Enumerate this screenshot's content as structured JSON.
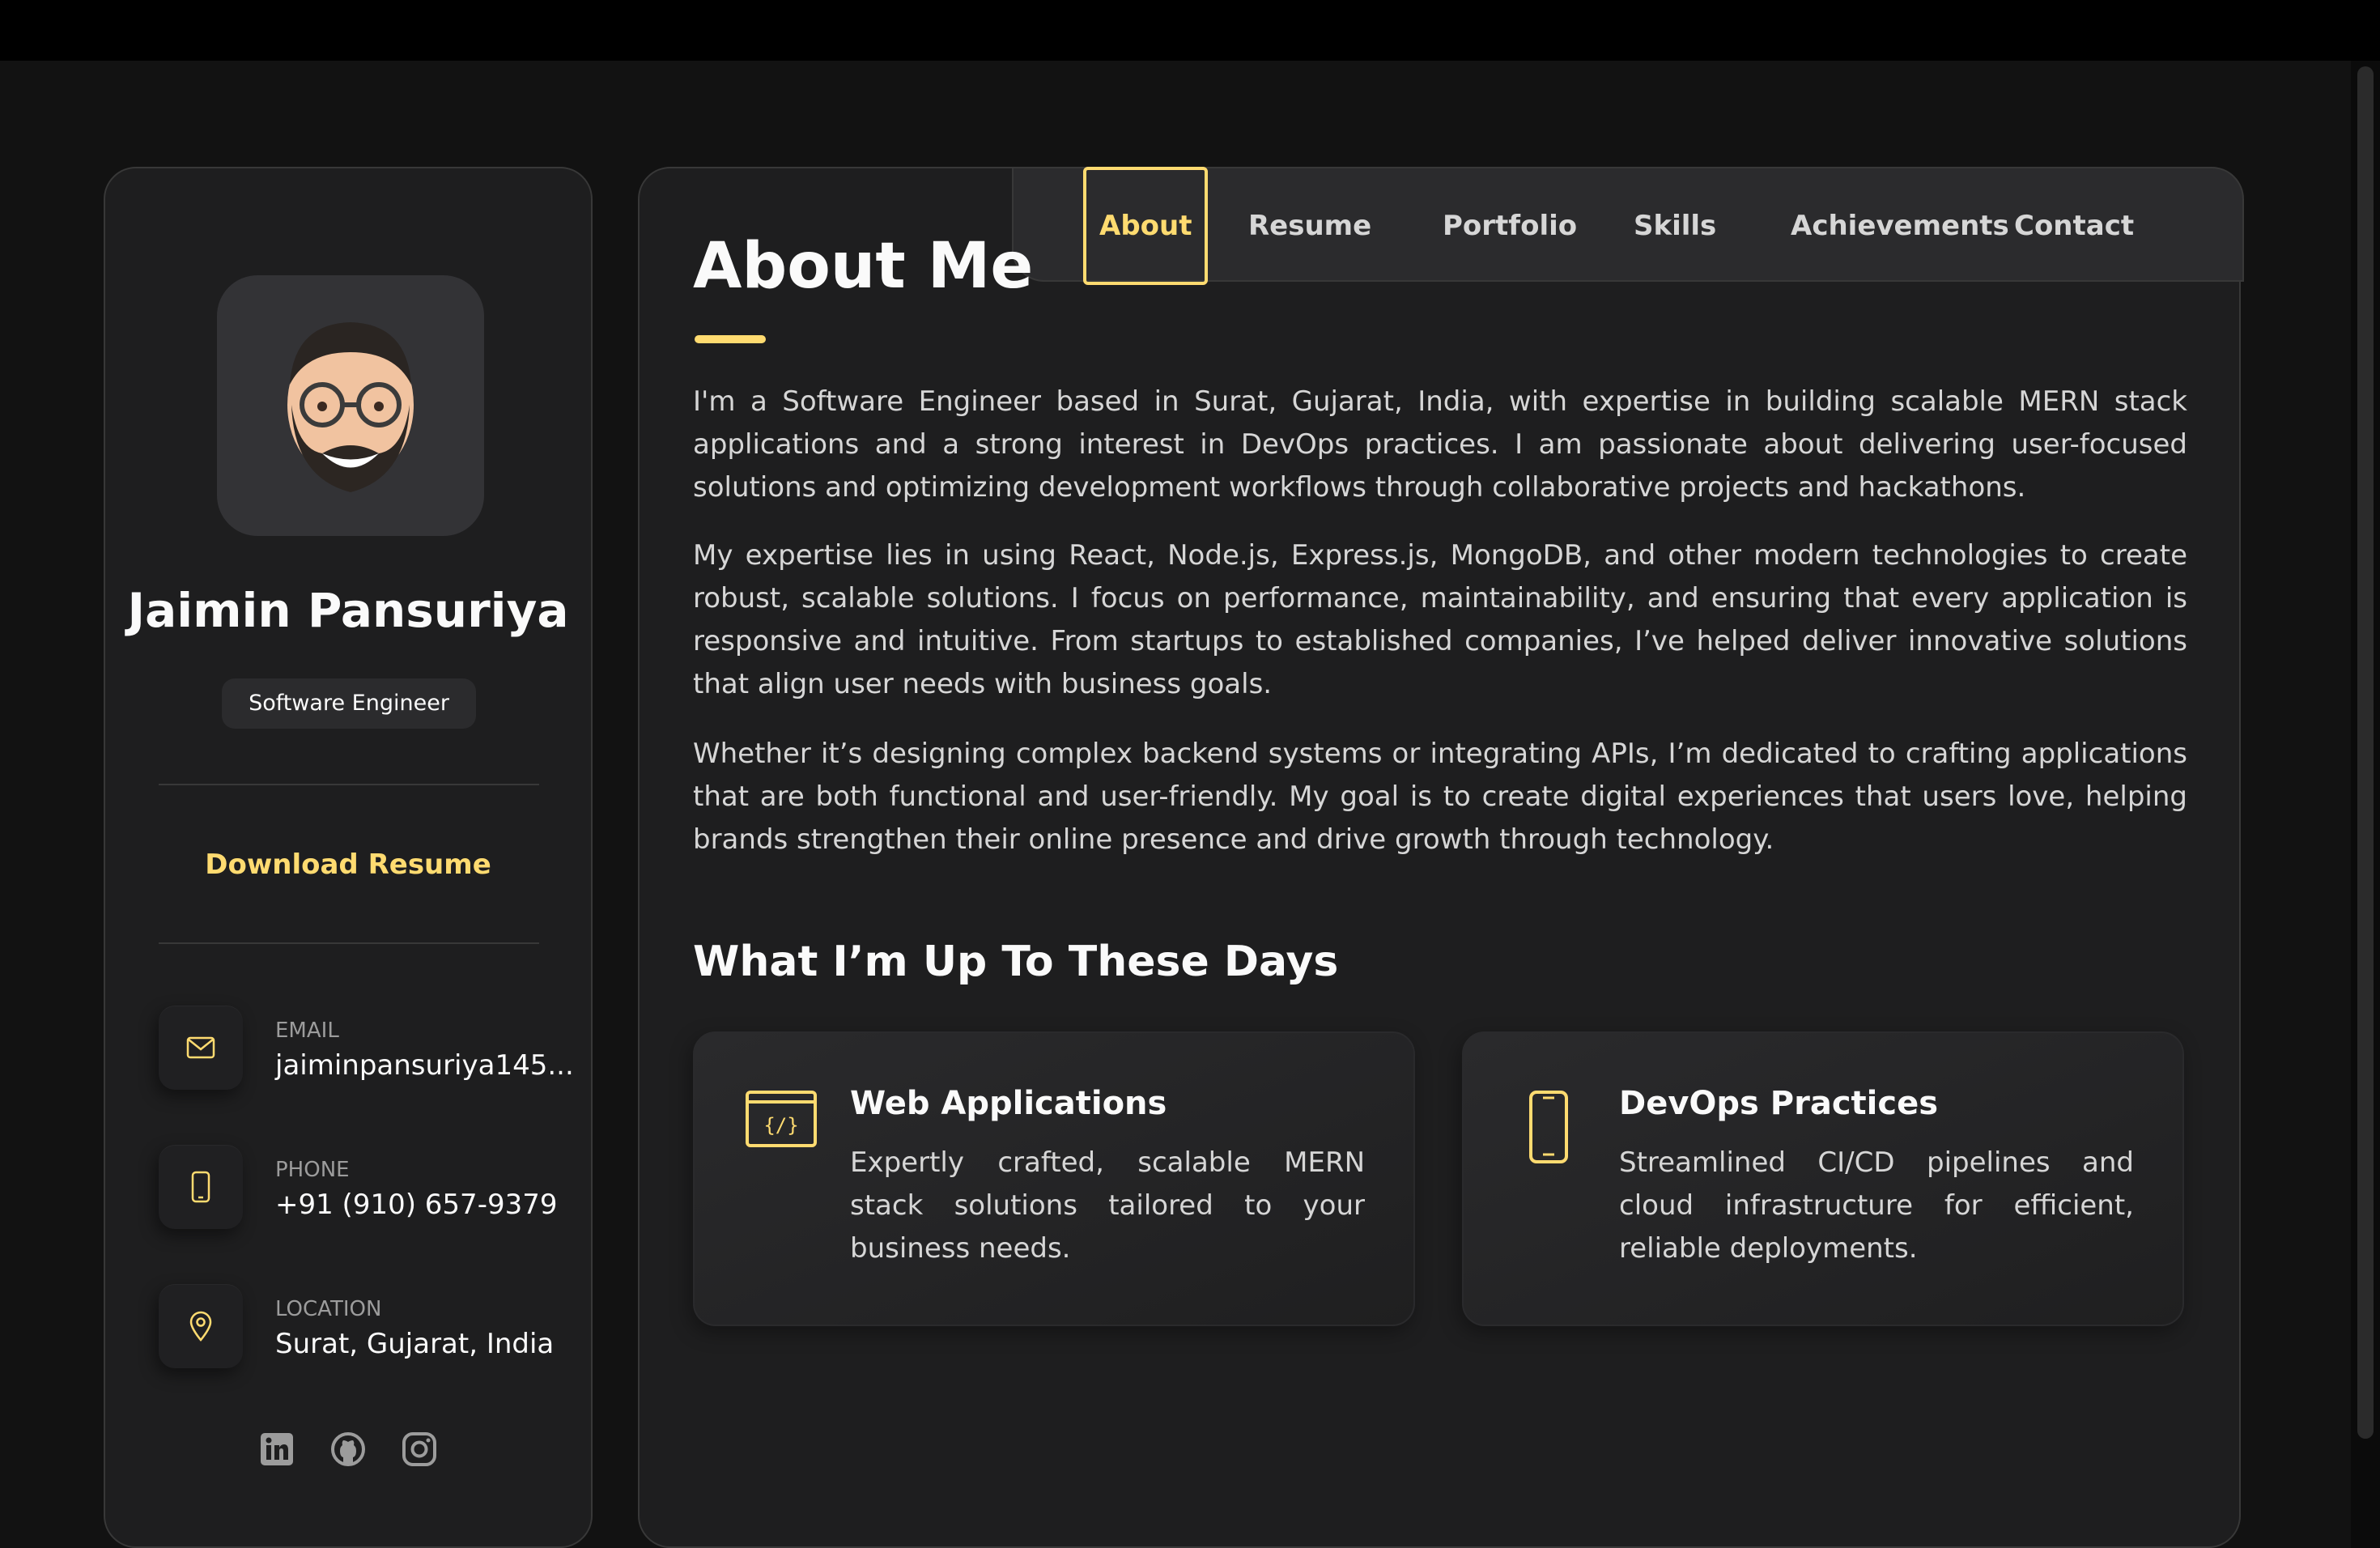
{
  "sidebar": {
    "name": "Jaimin Pansuriya",
    "role": "Software Engineer",
    "download_label": "Download Resume",
    "contacts": [
      {
        "label": "EMAIL",
        "value": "jaiminpansuriya145...",
        "icon": "mail-icon"
      },
      {
        "label": "PHONE",
        "value": "+91 (910) 657-9379",
        "icon": "phone-icon"
      },
      {
        "label": "LOCATION",
        "value": "Surat, Gujarat, India",
        "icon": "location-pin-icon"
      }
    ],
    "socials": [
      "linkedin-icon",
      "github-icon",
      "instagram-icon"
    ]
  },
  "navbar": {
    "items": [
      "About",
      "Resume",
      "Portfolio",
      "Skills",
      "Achievements",
      "Contact"
    ],
    "active": "About"
  },
  "about": {
    "title": "About Me",
    "paragraphs": [
      "I'm a Software Engineer based in Surat, Gujarat, India, with expertise in building scalable MERN stack applications and a strong interest in DevOps practices. I am passionate about delivering user-focused solutions and optimizing development workflows through collaborative projects and hackathons.",
      "My expertise lies in using React, Node.js, Express.js, MongoDB, and other modern technologies to create robust, scalable solutions. I focus on performance, maintainability, and ensuring that every application is responsive and intuitive. From startups to established companies, I’ve helped deliver innovative solutions that align user needs with business goals.",
      "Whether it’s designing complex backend systems or integrating APIs, I’m dedicated to crafting applications that are both functional and user-friendly. My goal is to create digital experiences that users love, helping brands strengthen their online presence and drive growth through technology."
    ],
    "services_title": "What I’m Up To These Days",
    "services": [
      {
        "title": "Web Applications",
        "text": "Expertly crafted, scalable MERN stack solutions tailored to your business needs.",
        "icon": "code-window-icon"
      },
      {
        "title": "DevOps Practices",
        "text": "Streamlined CI/CD pipelines and cloud infrastructure for efficient, reliable deployments.",
        "icon": "smartphone-icon"
      }
    ]
  },
  "colors": {
    "accent": "#ffdb70",
    "background": "#121212",
    "card": "#1e1e1f"
  }
}
